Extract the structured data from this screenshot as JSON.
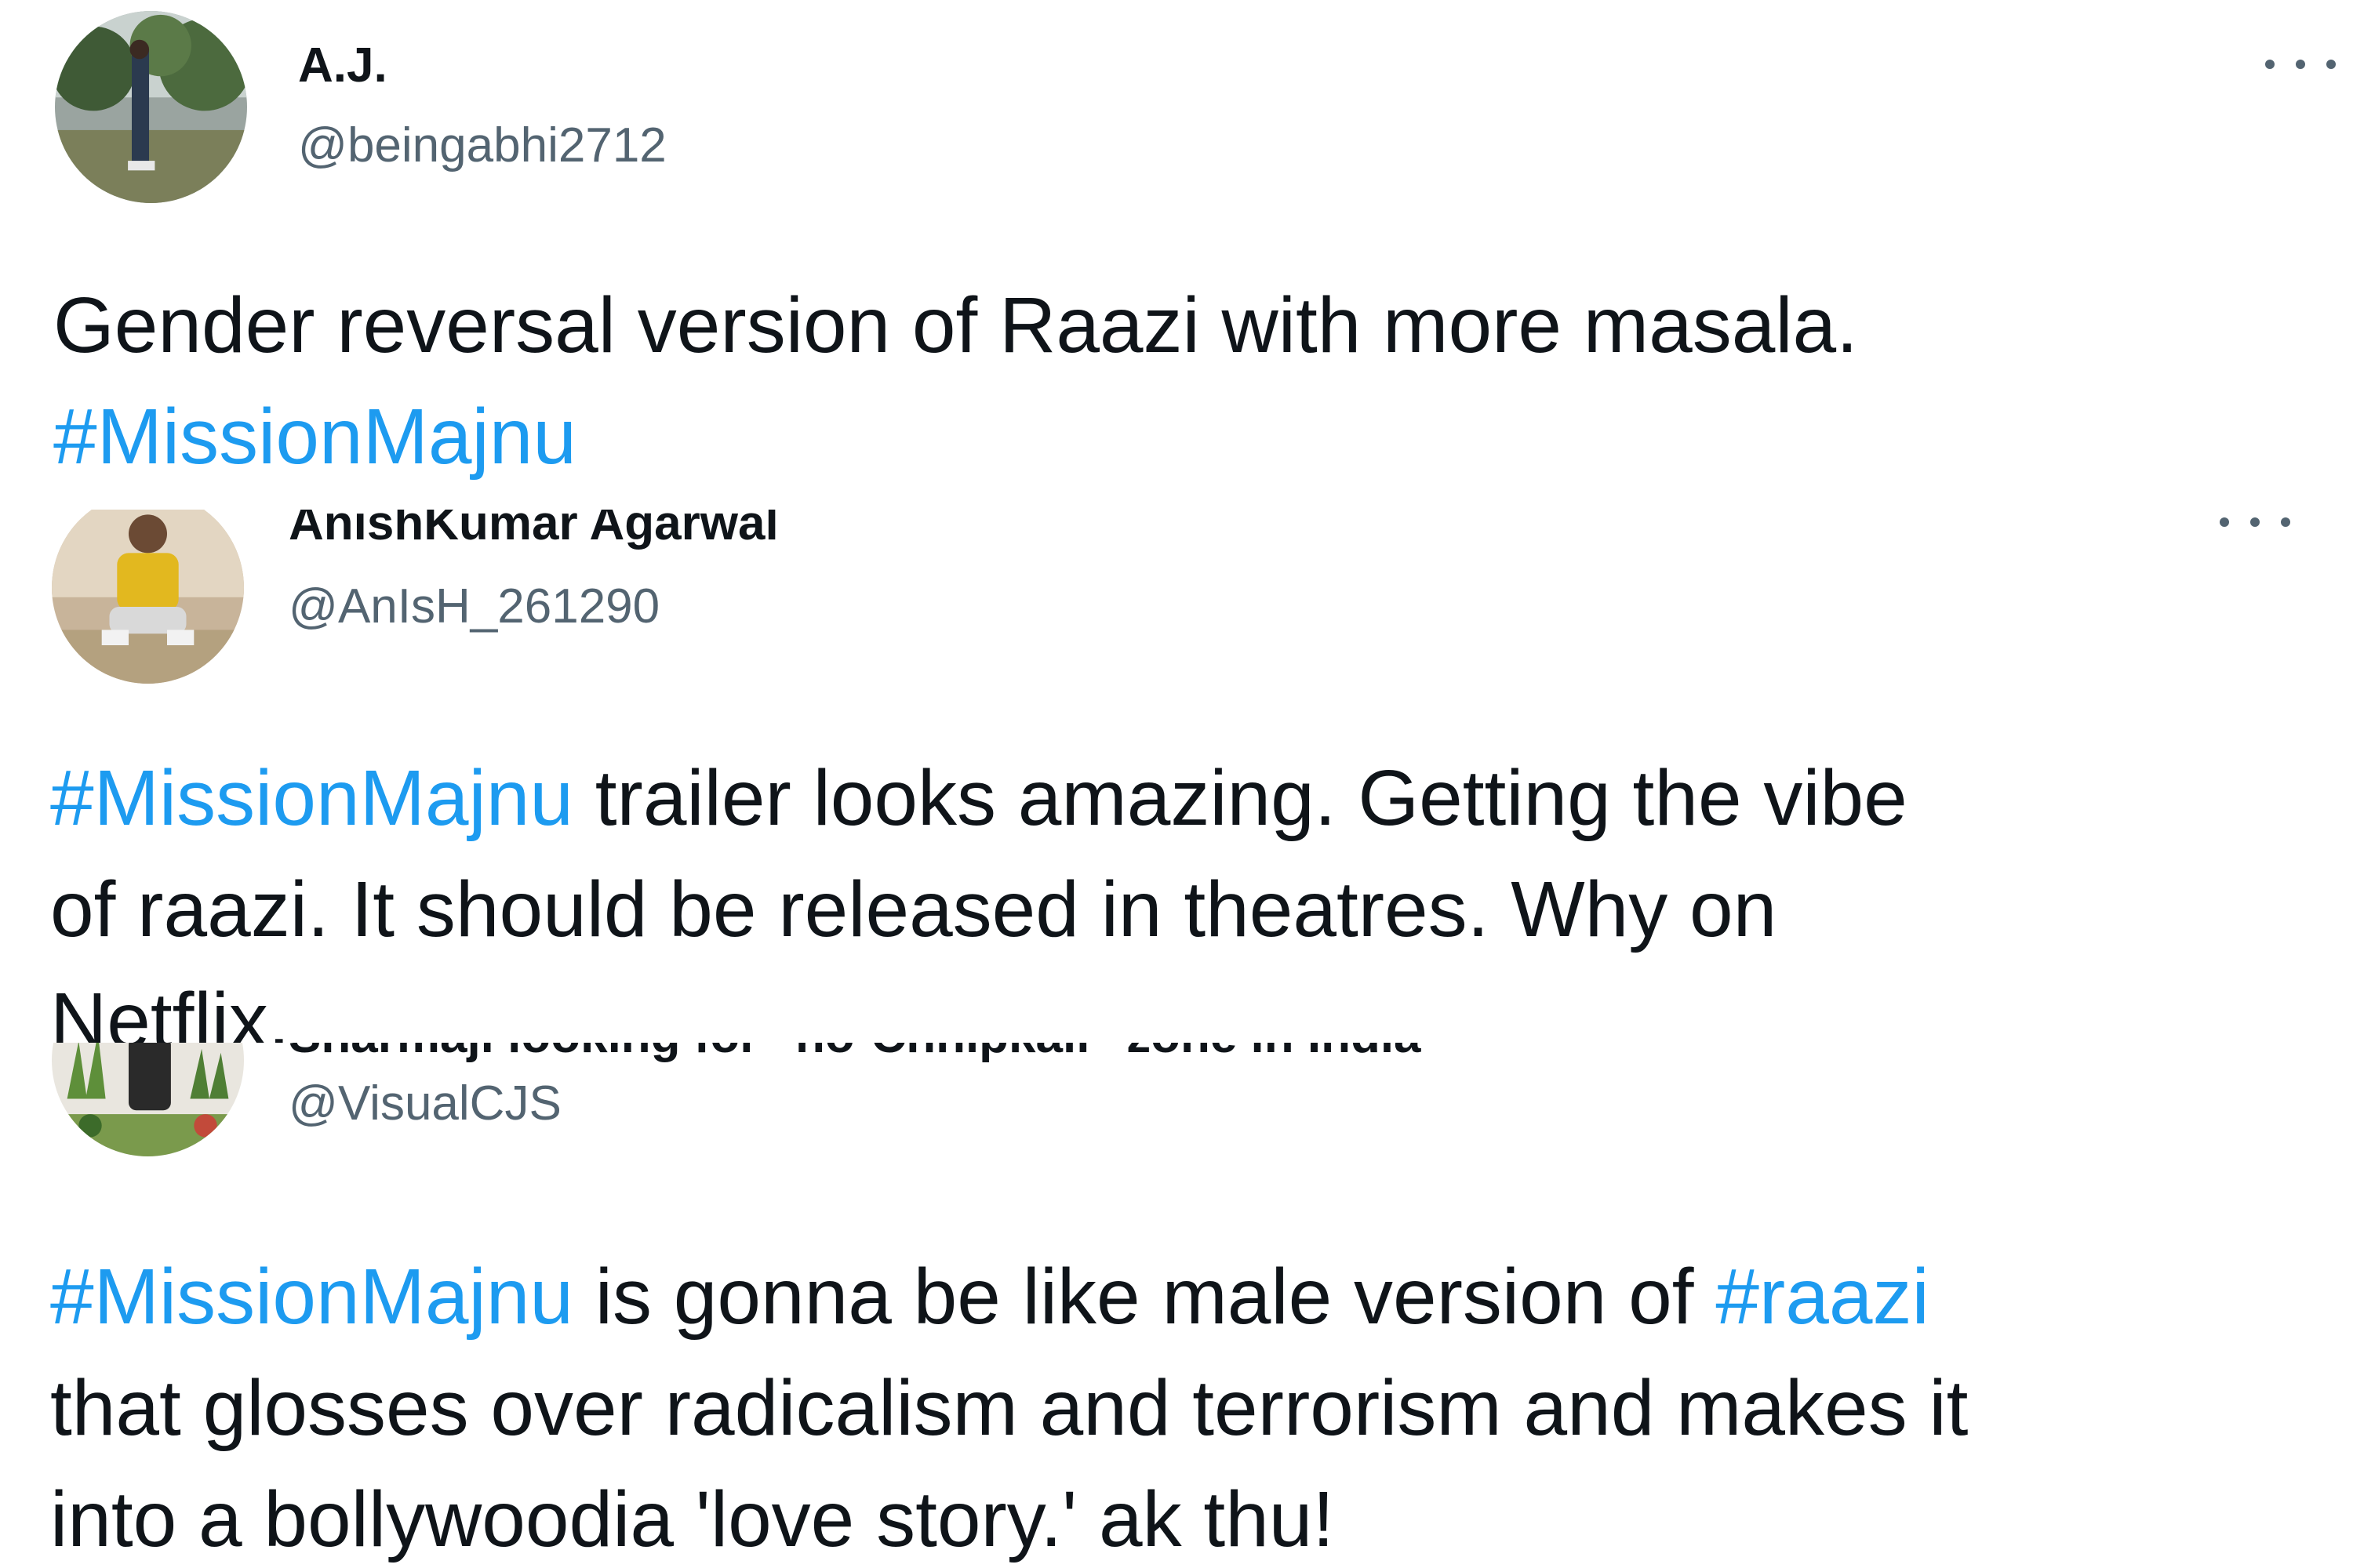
{
  "tweets": [
    {
      "display_name": "A.J.",
      "handle": "@beingabhi2712",
      "more_icon": "more-horizontal-icon",
      "text_lines": [
        {
          "pre": "",
          "tag1": "",
          "mid": "Gender reversal version of Raazi with more masala.",
          "tag2": "",
          "post": ""
        },
        {
          "pre": "",
          "tag1": "#MissionMajnu",
          "mid": "",
          "tag2": "",
          "post": ""
        }
      ]
    },
    {
      "display_name": "AnishKumar Agarwal",
      "handle": "@AnIsH_261290",
      "more_icon": "more-horizontal-icon",
      "text_lines": [
        {
          "pre": "",
          "tag1": "#MissionMajnu",
          "mid": " trailer looks amazing. Getting the vibe",
          "tag2": "",
          "post": ""
        },
        {
          "pre": "",
          "tag1": "",
          "mid": "of raazi. It should be released in theatres. Why on",
          "tag2": "",
          "post": ""
        },
        {
          "pre": "",
          "tag1": "",
          "mid": "Netflix.",
          "tag2": "",
          "post": ""
        }
      ]
    },
    {
      "display_name": "Sharmaji looking for \"no-Chhipkali\" zone in India",
      "handle": "@VisualCJS",
      "more_icon": "more-horizontal-icon",
      "text_lines": [
        {
          "pre": "",
          "tag1": "#MissionMajnu",
          "mid": " is gonna be like male version of ",
          "tag2": "#raazi",
          "post": ""
        },
        {
          "pre": "",
          "tag1": "",
          "mid": "that glosses over radicalism and terrorism and makes it",
          "tag2": "",
          "post": ""
        },
        {
          "pre": "",
          "tag1": "",
          "mid": "into a bollywoodia 'love story.' ak thu!",
          "tag2": "",
          "post": ""
        }
      ]
    }
  ],
  "colors": {
    "text": "#0f1419",
    "secondary": "#536471",
    "hashtag": "#1d9bf0",
    "background": "#ffffff"
  }
}
